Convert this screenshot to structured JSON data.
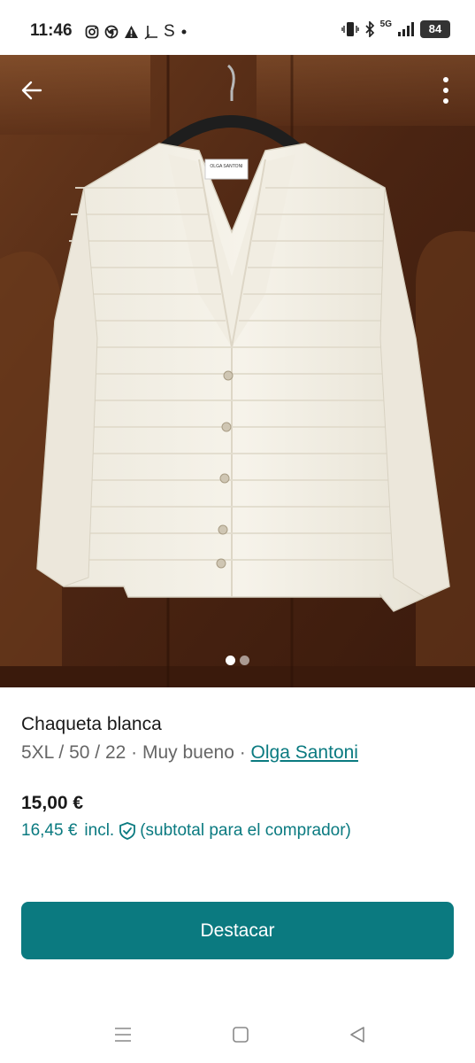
{
  "status_bar": {
    "time": "11:46",
    "left_icons": [
      "instagram-icon",
      "chrome-icon",
      "warning-icon",
      "l-icon",
      "s-icon",
      "dot-icon"
    ],
    "s_label": "S",
    "net_label": "5G",
    "battery": "84"
  },
  "photo": {
    "alt": "Chaqueta blanca",
    "pages": 2,
    "active_page": 1,
    "tag_text": "OLGA SANTONI"
  },
  "item": {
    "title": "Chaqueta blanca",
    "meta_prefix": "5XL / 50 / 22 · Muy bueno · ",
    "brand": "Olga Santoni",
    "price": "15,00 €",
    "buyer_price": "16,45 €",
    "incl_label": "incl.",
    "buyer_note": "(subtotal para el comprador)"
  },
  "actions": {
    "primary_label": "Destacar"
  },
  "colors": {
    "accent": "#0b7a80",
    "link": "#0a7a80",
    "muted_text": "#666666"
  },
  "navbar": {
    "icons": [
      "menu-icon",
      "home-icon",
      "back-triangle-icon"
    ]
  }
}
